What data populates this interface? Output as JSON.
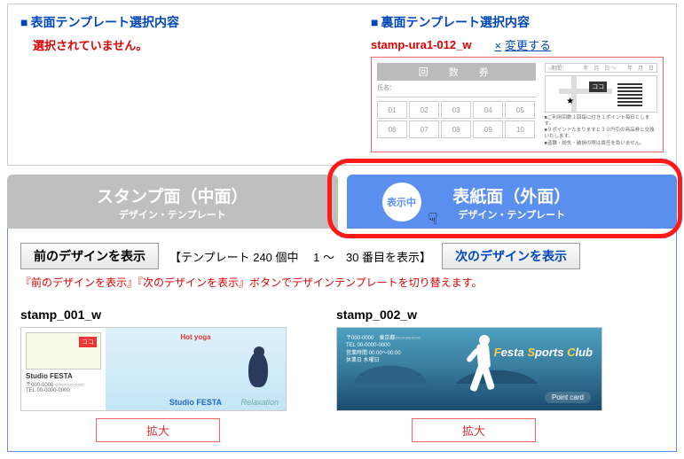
{
  "front": {
    "heading": "表面テンプレート選択内容",
    "not_selected": "選択されていません。"
  },
  "back": {
    "heading": "裏面テンプレート選択内容",
    "selected_name": "stamp-ura1-012_w",
    "change_x": "×",
    "change_label": "変更する",
    "preview": {
      "header": "回　数　券",
      "name_label": "氏名：",
      "cells": [
        "01",
        "02",
        "03",
        "04",
        "05",
        "06",
        "07",
        "08",
        "09",
        "10"
      ],
      "period_label": "○期間：",
      "period_value": "年　月　日 ～　　年　月　日",
      "map_mark": "ココ",
      "notes": [
        "■ご利用回数１回毎に付き１ポイント毎日とします。",
        "■９ポイントたまりますと３０円引の商品券と交換いたします。",
        "■盗難・紛失・破損の際は責任を負いません。"
      ]
    }
  },
  "tabs": {
    "inactive": {
      "title": "スタンプ面（中面）",
      "sub": "デザイン・テンプレート"
    },
    "active": {
      "badge": "表示中",
      "title": "表紙面（外面）",
      "sub": "デザイン・テンプレート"
    }
  },
  "nav": {
    "prev": "前のデザインを表示",
    "count_text": "【テンプレート 240 個中　 1 ～　30 番目を表示】",
    "next": "次のデザインを表示",
    "hint": "『前のデザインを表示』『次のデザインを表示』ボタンでデザインテンプレートを切り替えます。"
  },
  "cards": [
    {
      "name": "stamp_001_w",
      "zoom": "拡大",
      "map_mark": "ココ",
      "brand_small": "Hot yoga",
      "relax": "Relaxation",
      "studio": "Studio FESTA",
      "studio_left": "Studio FESTA",
      "addr": "〒000-0000 ○○○○○○○○○",
      "tel": "TEL 00-0000-0000"
    },
    {
      "name": "stamp_002_w",
      "zoom": "拡大",
      "info1": "〒000-0000　東京都○○○○○○○○",
      "info2": "TEL 00-0000-0000",
      "info3": "営業時間 00:00～00:00",
      "info4": "休業日 水曜日",
      "brand_parts": [
        "F",
        "esta ",
        "S",
        "ports ",
        "C",
        "lub"
      ],
      "point": "Point card"
    }
  ]
}
